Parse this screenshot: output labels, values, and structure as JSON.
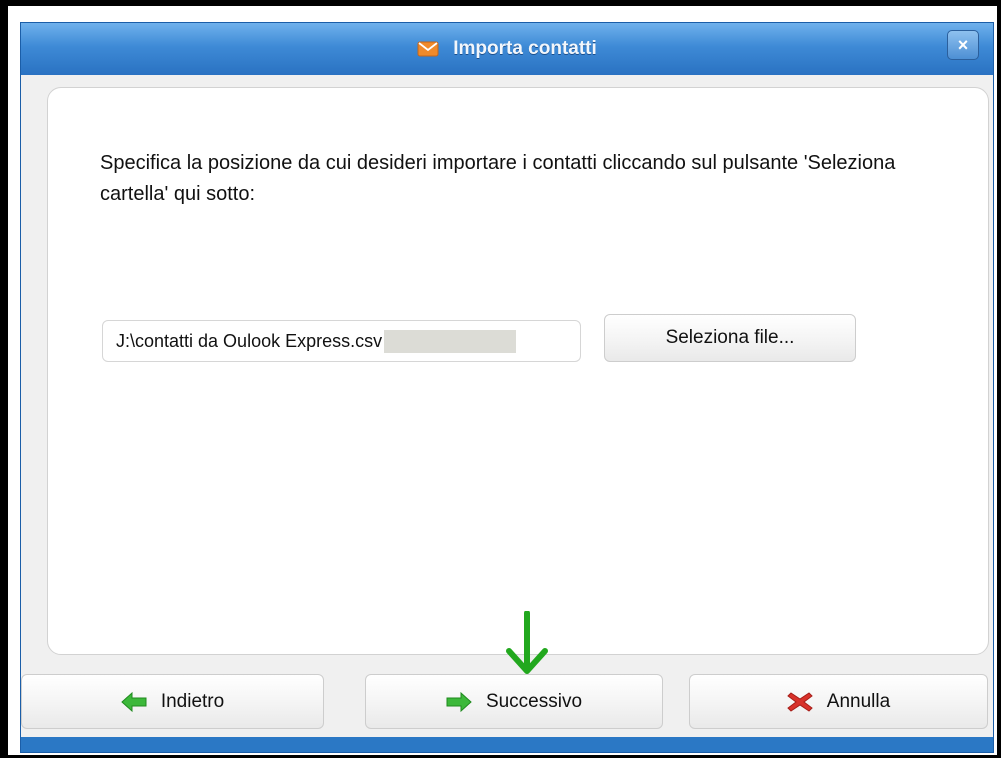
{
  "window": {
    "title": "Importa contatti",
    "close_label": "×"
  },
  "content": {
    "instructions": "Specifica la posizione da cui desideri importare i contatti cliccando sul pulsante 'Seleziona cartella' qui sotto:",
    "file_path_value": "J:\\contatti da Oulook Express.csv",
    "browse_label": "Seleziona file..."
  },
  "buttons": {
    "back_label": "Indietro",
    "next_label": "Successivo",
    "cancel_label": "Annulla"
  },
  "icons": {
    "title": "mail-icon",
    "back": "arrow-left-icon",
    "next": "arrow-right-icon",
    "cancel": "x-mark-icon",
    "annotation": "arrow-down-icon"
  },
  "colors": {
    "titlebar": "#3e8ad6",
    "arrow_green": "#2eaa2a",
    "cancel_red": "#d8312a",
    "annotation_green": "#22a81e"
  }
}
